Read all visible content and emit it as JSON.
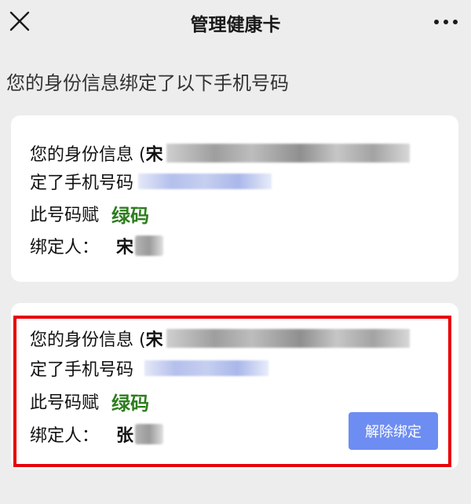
{
  "nav": {
    "title": "管理健康卡",
    "close_icon": "close-icon",
    "more_icon": "more-dots-icon"
  },
  "subtitle": "您的身份信息绑定了以下手机号码",
  "cards": [
    {
      "line1_prefix": "您的身份信息 (",
      "line1_name": "宋",
      "line2": "定了手机号码",
      "line3_prefix": "此号码赋",
      "status": "绿码",
      "line4_prefix": "绑定人：",
      "bound_name": "宋"
    },
    {
      "line1_prefix": "您的身份信息 (",
      "line1_name": "宋",
      "line2": "定了手机号码",
      "line3_prefix": "此号码赋",
      "status": "绿码",
      "line4_prefix": "绑定人：",
      "bound_name": "张",
      "unbind_label": "解除绑定"
    }
  ],
  "colors": {
    "status_green": "#2e7d1f",
    "highlight_red": "#e8000b",
    "button_blue": "#6e8df2"
  }
}
